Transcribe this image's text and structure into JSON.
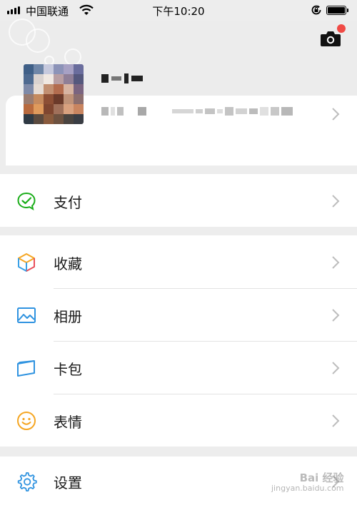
{
  "status_bar": {
    "carrier": "中国联通",
    "time": "下午10:20"
  },
  "profile": {
    "chevron_icon": "chevron-right-icon"
  },
  "menu": {
    "pay": {
      "label": "支付",
      "icon": "pay-icon"
    },
    "favorites": {
      "label": "收藏",
      "icon": "cube-icon"
    },
    "album": {
      "label": "相册",
      "icon": "picture-icon"
    },
    "cards": {
      "label": "卡包",
      "icon": "card-icon"
    },
    "stickers": {
      "label": "表情",
      "icon": "smiley-icon"
    },
    "settings": {
      "label": "设置",
      "icon": "gear-icon"
    }
  },
  "watermark": {
    "brand": "Bai 经验",
    "url": "jingyan.baidu.com"
  },
  "colors": {
    "background": "#ededed",
    "green_accent": "#1aad19",
    "notification_dot": "#f04a45",
    "divider": "#e3e3e3"
  }
}
